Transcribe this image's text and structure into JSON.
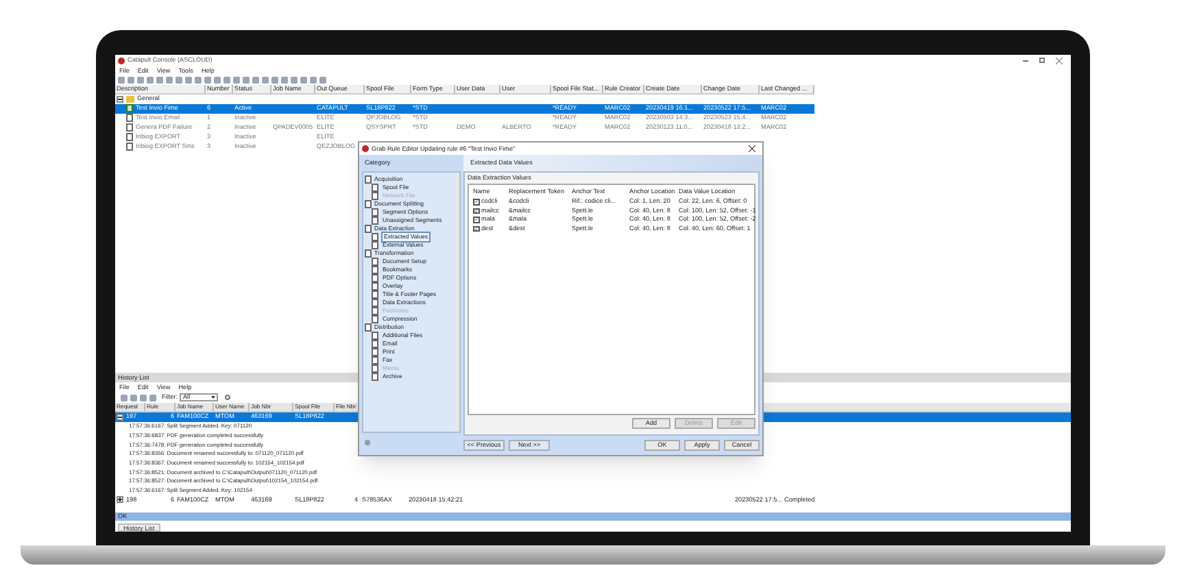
{
  "window": {
    "title": "Catapult Console (ASCLOUD)"
  },
  "menu": [
    "File",
    "Edit",
    "View",
    "Tools",
    "Help"
  ],
  "rules_table": {
    "columns": [
      "Description",
      "Number",
      "Status",
      "Job Name",
      "Out Queue",
      "Spool File",
      "Form Type",
      "User Data",
      "User",
      "Spool File Stat...",
      "Rule Creator",
      "Create Date",
      "Change Date",
      "Last Changed ..."
    ],
    "group": {
      "label": "General",
      "expanded": true
    },
    "rows": [
      {
        "selected": true,
        "active": true,
        "cells": [
          "Test Invio Fime",
          "6",
          "Active",
          null,
          "CATAPULT",
          "SL18P822",
          "*STD",
          null,
          null,
          "*READY",
          "MARC02",
          "20230419 16:1...",
          "20230522 17:5...",
          "MARC02"
        ]
      },
      {
        "selected": false,
        "active": false,
        "cells": [
          "Test Invio Email",
          "1",
          "Inactive",
          null,
          "ELITE",
          "QPJOBLOG",
          "*STD",
          null,
          null,
          "*READY",
          "MARC02",
          "20230503 14:3...",
          "20230523 15:4...",
          "MARC02"
        ]
      },
      {
        "selected": false,
        "active": false,
        "cells": [
          "Genera PDF Failure",
          "2",
          "Inactive",
          "QPADEV0005",
          "ELITE",
          "QSYSPRT",
          "*STD",
          "DEMO",
          "ALBERTO",
          "*READY",
          "MARC02",
          "20230123 11:0...",
          "20230418 13:2...",
          "MARC02"
        ]
      },
      {
        "selected": false,
        "active": false,
        "cells": [
          "Inbiog EXPORT",
          "3",
          "Inactive",
          null,
          "ELITE"
        ]
      },
      {
        "selected": false,
        "active": false,
        "cells": [
          "Inbiog EXPORT Sms",
          "3",
          "Inactive",
          null,
          "QEZJOBLOG"
        ]
      }
    ]
  },
  "history": {
    "title": "History List",
    "menu": [
      "File",
      "Edit",
      "View",
      "Help"
    ],
    "filter_label": "Filter:",
    "filter_value": "All",
    "columns": [
      "Request",
      "Rule",
      "Job Name",
      "User Name",
      "Job Nbr",
      "Spool File",
      "File Nbr"
    ],
    "rows": [
      {
        "selected": true,
        "expanded": true,
        "cells": [
          "197",
          "6",
          "FAM100CZ",
          "MTOM",
          "463169",
          "SL18P822"
        ],
        "log": [
          "17:57:36:6167: Split Segment Added. Key: 071120",
          "17:57:36:6837: PDF generation completed successfully",
          "17:57:36:7478: PDF generation completed successfully",
          "17:57:36:8356: Document renamed successfully to: 071120_071120.pdf",
          "17:57:36:8367: Document renamed successfully to: 102154_102154.pdf",
          "17:57:36:8521: Document archived to C:\\Catapult\\Output\\071120_071120.pdf",
          "17:57:36:8527: Document archived to C:\\Catapult\\Output\\102154_102154.pdf",
          "17:57:36:6167: Split Segment Added. Key: 102154"
        ]
      },
      {
        "selected": false,
        "expanded": false,
        "cells": [
          "198",
          "6",
          "FAM100CZ",
          "MTOM",
          "463169",
          "SL18P822",
          "4"
        ],
        "extra": [
          "S78536AX",
          "20230418 15:42:21",
          "20230522 17:5...",
          "Completed"
        ]
      }
    ],
    "status": "OK",
    "tab": "History List"
  },
  "dialog": {
    "title": "Grab Rule Editor Updating rule #6 \"Test Invio Fime\"",
    "category_label": "Category",
    "tree": [
      {
        "label": "Acquisition",
        "children": [
          {
            "label": "Spool File",
            "disabled": false,
            "selected": false
          },
          {
            "label": "Network File",
            "disabled": true,
            "selected": false
          }
        ]
      },
      {
        "label": "Document Splitting",
        "children": [
          {
            "label": "Segment Options",
            "disabled": false,
            "selected": false
          },
          {
            "label": "Unassigned Segments",
            "disabled": false,
            "selected": false
          }
        ]
      },
      {
        "label": "Data Extraction",
        "children": [
          {
            "label": "Extracted Values",
            "disabled": false,
            "selected": true
          },
          {
            "label": "External Values",
            "disabled": false,
            "selected": false
          }
        ]
      },
      {
        "label": "Transformation",
        "children": [
          {
            "label": "Document Setup",
            "disabled": false,
            "selected": false
          },
          {
            "label": "Bookmarks",
            "disabled": false,
            "selected": false
          },
          {
            "label": "PDF Options",
            "disabled": false,
            "selected": false
          },
          {
            "label": "Overlay",
            "disabled": false,
            "selected": false
          },
          {
            "label": "Title & Footer Pages",
            "disabled": false,
            "selected": false
          },
          {
            "label": "Data Extractions",
            "disabled": false,
            "selected": false
          },
          {
            "label": "Footnotes",
            "disabled": true,
            "selected": false
          },
          {
            "label": "Compression",
            "disabled": false,
            "selected": false
          }
        ]
      },
      {
        "label": "Distribution",
        "children": [
          {
            "label": "Additional Files",
            "disabled": false,
            "selected": false
          },
          {
            "label": "Email",
            "disabled": false,
            "selected": false
          },
          {
            "label": "Print",
            "disabled": false,
            "selected": false
          },
          {
            "label": "Fax",
            "disabled": false,
            "selected": false
          },
          {
            "label": "Memo",
            "disabled": true,
            "selected": false
          },
          {
            "label": "Archive",
            "disabled": false,
            "selected": false
          }
        ]
      }
    ],
    "panel_title": "Extracted Data Values",
    "group_label": "Data Extraction Values",
    "columns": [
      "Name",
      "Replacement Token",
      "Anchor Text",
      "Anchor Location",
      "Data Value Location"
    ],
    "rows": [
      {
        "checked": true,
        "cells": [
          "codcli",
          "&codcli",
          "Rif.: codice cli...",
          "Col: 1, Len: 20",
          "Col: 22, Len: 6, Offset: 0"
        ]
      },
      {
        "checked": true,
        "cells": [
          "mailcc",
          "&mailcc",
          "Spett.le",
          "Col: 40, Len: 8",
          "Col: 100, Len: 52, Offset: -1"
        ]
      },
      {
        "checked": true,
        "cells": [
          "mala",
          "&mala",
          "Spett.le",
          "Col: 40, Len: 8",
          "Col: 100, Len: 52, Offset: -2"
        ]
      },
      {
        "checked": true,
        "cells": [
          "dest",
          "&dest",
          "Spett.le",
          "Col: 40, Len: 8",
          "Col: 40, Len: 60, Offset: 1"
        ]
      }
    ],
    "row_buttons": [
      {
        "label": "Add",
        "disabled": false
      },
      {
        "label": "Delete",
        "disabled": true
      },
      {
        "label": "Edit",
        "disabled": true
      }
    ],
    "nav_buttons": [
      "<< Previous",
      "Next >>"
    ],
    "footer_buttons": [
      "OK",
      "Apply",
      "Cancel"
    ]
  }
}
